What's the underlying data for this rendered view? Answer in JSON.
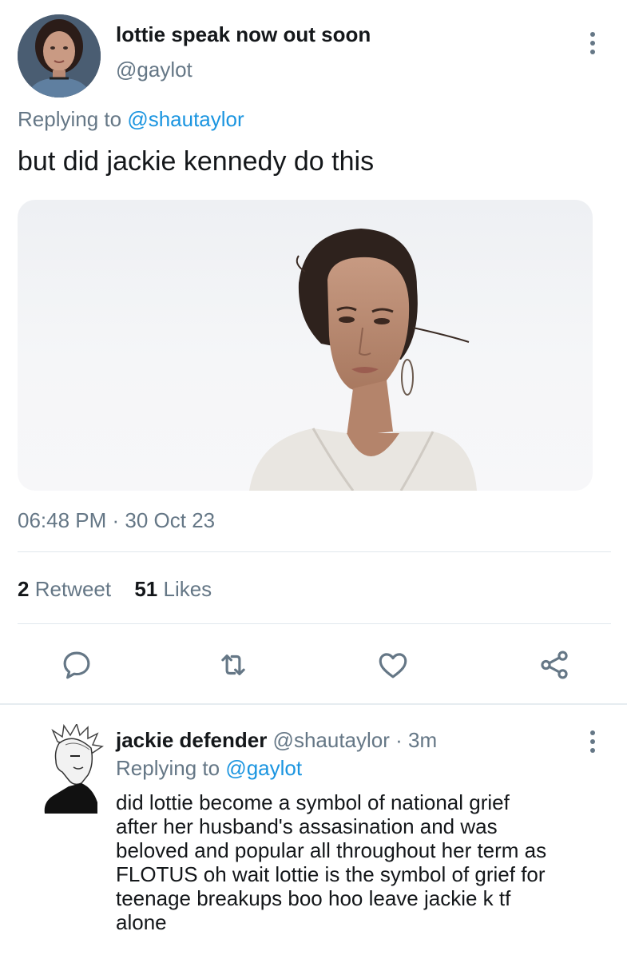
{
  "main_tweet": {
    "display_name": "lottie speak now out soon",
    "handle": "@gaylot",
    "replying_prefix": "Replying to",
    "replying_to": "@shautaylor",
    "text": "but did jackie kennedy do this",
    "timestamp": "06:48 PM · 30 Oct 23",
    "stats": {
      "retweets_count": "2",
      "retweets_label": "Retweet",
      "likes_count": "51",
      "likes_label": "Likes"
    },
    "actions": [
      "reply-icon",
      "retweet-icon",
      "like-icon",
      "share-icon"
    ]
  },
  "reply_tweet": {
    "display_name": "jackie defender",
    "meta": "@shautaylor · 3m",
    "replying_prefix": "Replying to",
    "replying_to": "@gaylot",
    "lines": [
      "did lottie become a symbol of national grief",
      "after her husband's assasination and was",
      "beloved and popular all throughout her term as",
      "FLOTUS oh wait lottie is the symbol of grief for",
      "teenage breakups boo hoo leave jackie k tf",
      "alone"
    ]
  },
  "colors": {
    "text_primary": "#14171a",
    "text_secondary": "#657786",
    "link": "#1b95e0",
    "divider": "#e1e8ed"
  }
}
